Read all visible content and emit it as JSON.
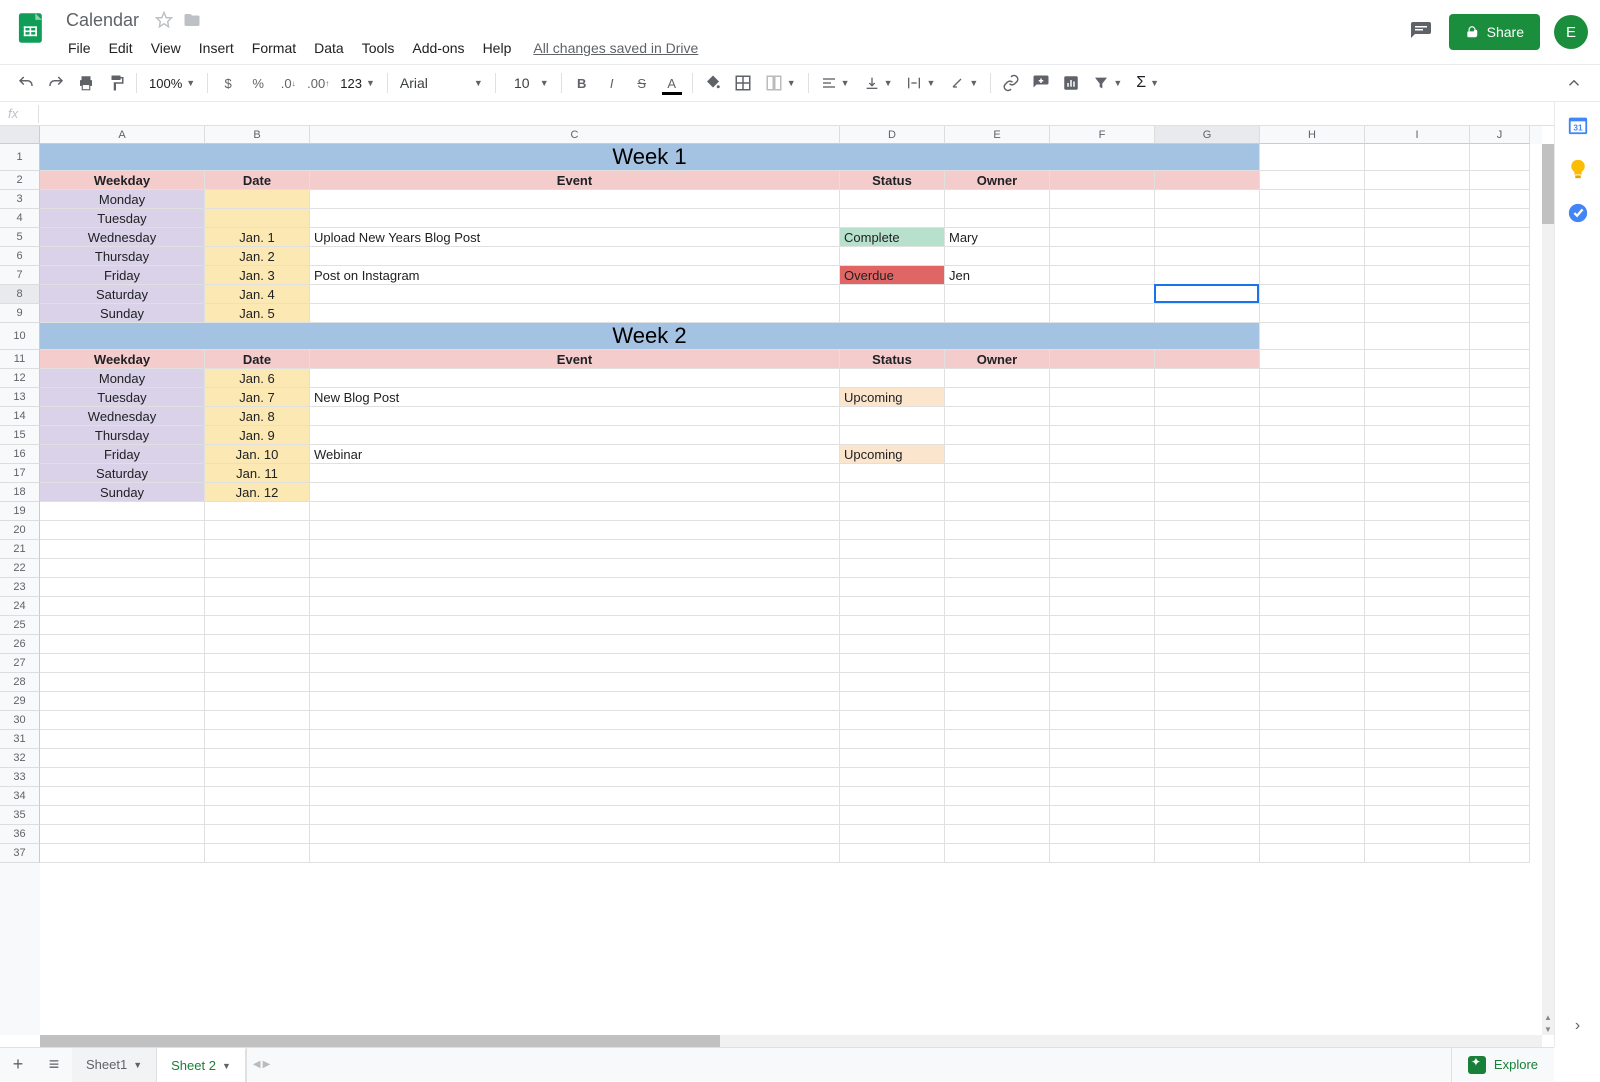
{
  "doc_title": "Calendar",
  "save_status": "All changes saved in Drive",
  "menus": [
    "File",
    "Edit",
    "View",
    "Insert",
    "Format",
    "Data",
    "Tools",
    "Add-ons",
    "Help"
  ],
  "toolbar": {
    "zoom": "100%",
    "format_123": "123",
    "font": "Arial",
    "font_size": "10"
  },
  "share_label": "Share",
  "avatar_letter": "E",
  "fx_label": "fx",
  "explore_label": "Explore",
  "sheet_tabs": [
    {
      "name": "Sheet1",
      "active": false
    },
    {
      "name": "Sheet 2",
      "active": true
    }
  ],
  "col_widths": {
    "A": 165,
    "B": 105,
    "C": 530,
    "D": 105,
    "E": 105,
    "F": 105,
    "G": 105,
    "H": 105,
    "I": 105,
    "J": 60
  },
  "col_letters": [
    "A",
    "B",
    "C",
    "D",
    "E",
    "F",
    "G",
    "H",
    "I",
    "J"
  ],
  "visible_rows": 37,
  "selected_cell": {
    "row": 8,
    "col": "G"
  },
  "blocks": [
    {
      "title": "Week 1",
      "title_row": 1,
      "header_row": 2,
      "headers": [
        "Weekday",
        "Date",
        "Event",
        "Status",
        "Owner"
      ],
      "data_start": 3,
      "rows": [
        {
          "weekday": "Monday",
          "date": "",
          "event": "",
          "status": "",
          "owner": ""
        },
        {
          "weekday": "Tuesday",
          "date": "",
          "event": "",
          "status": "",
          "owner": ""
        },
        {
          "weekday": "Wednesday",
          "date": "Jan. 1",
          "event": "Upload New Years Blog Post",
          "status": "Complete",
          "status_style": "green",
          "owner": "Mary"
        },
        {
          "weekday": "Thursday",
          "date": "Jan. 2",
          "event": "",
          "status": "",
          "owner": ""
        },
        {
          "weekday": "Friday",
          "date": "Jan. 3",
          "event": "Post on Instagram",
          "status": "Overdue",
          "status_style": "red",
          "owner": "Jen"
        },
        {
          "weekday": "Saturday",
          "date": "Jan. 4",
          "event": "",
          "status": "",
          "owner": ""
        },
        {
          "weekday": "Sunday",
          "date": "Jan. 5",
          "event": "",
          "status": "",
          "owner": ""
        }
      ]
    },
    {
      "title": "Week 2",
      "title_row": 10,
      "header_row": 11,
      "headers": [
        "Weekday",
        "Date",
        "Event",
        "Status",
        "Owner"
      ],
      "data_start": 12,
      "rows": [
        {
          "weekday": "Monday",
          "date": "Jan. 6",
          "event": "",
          "status": "",
          "owner": ""
        },
        {
          "weekday": "Tuesday",
          "date": "Jan. 7",
          "event": "New Blog Post",
          "status": "Upcoming",
          "status_style": "orange",
          "owner": ""
        },
        {
          "weekday": "Wednesday",
          "date": "Jan. 8",
          "event": "",
          "status": "",
          "owner": ""
        },
        {
          "weekday": "Thursday",
          "date": "Jan. 9",
          "event": "",
          "status": "",
          "owner": ""
        },
        {
          "weekday": "Friday",
          "date": "Jan. 10",
          "event": "Webinar",
          "status": "Upcoming",
          "status_style": "orange",
          "owner": ""
        },
        {
          "weekday": "Saturday",
          "date": "Jan. 11",
          "event": "",
          "status": "",
          "owner": ""
        },
        {
          "weekday": "Sunday",
          "date": "Jan. 12",
          "event": "",
          "status": "",
          "owner": ""
        }
      ]
    }
  ]
}
